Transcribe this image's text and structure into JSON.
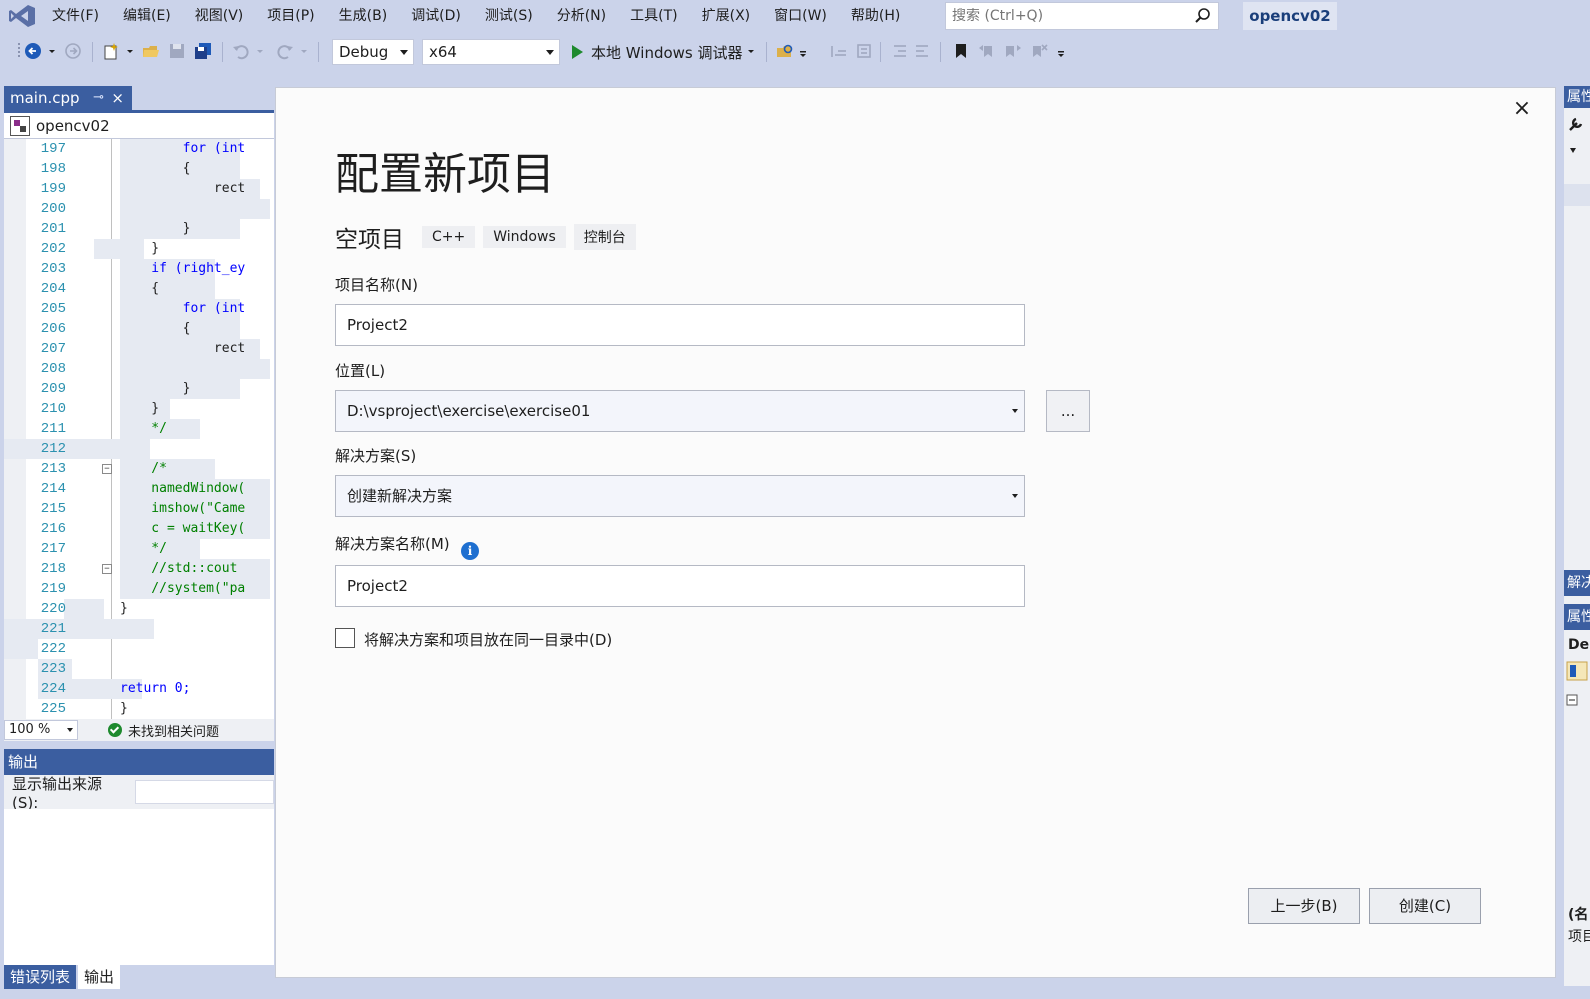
{
  "menubar": {
    "items": [
      "文件(F)",
      "编辑(E)",
      "视图(V)",
      "项目(P)",
      "生成(B)",
      "调试(D)",
      "测试(S)",
      "分析(N)",
      "工具(T)",
      "扩展(X)",
      "窗口(W)",
      "帮助(H)"
    ],
    "search_placeholder": "搜索 (Ctrl+Q)",
    "project_name": "opencv02"
  },
  "toolbar": {
    "config": "Debug",
    "platform": "x64",
    "run_label": "本地 Windows 调试器"
  },
  "editor": {
    "tab_name": "main.cpp",
    "tab_pin": "⊸",
    "tab_close": "×",
    "nav_project": "opencv02",
    "lines": [
      {
        "n": "197",
        "code": "        for (int",
        "kind": "kw"
      },
      {
        "n": "198",
        "code": "        {",
        "kind": "pl"
      },
      {
        "n": "199",
        "code": "            rect",
        "kind": "pl"
      },
      {
        "n": "200",
        "code": "",
        "kind": "pl"
      },
      {
        "n": "201",
        "code": "        }",
        "kind": "pl"
      },
      {
        "n": "202",
        "code": "    }",
        "kind": "pl"
      },
      {
        "n": "203",
        "code": "    if (right_ey",
        "kind": "kw"
      },
      {
        "n": "204",
        "code": "    {",
        "kind": "pl"
      },
      {
        "n": "205",
        "code": "        for (int",
        "kind": "kw"
      },
      {
        "n": "206",
        "code": "        {",
        "kind": "pl"
      },
      {
        "n": "207",
        "code": "            rect",
        "kind": "pl"
      },
      {
        "n": "208",
        "code": "",
        "kind": "pl"
      },
      {
        "n": "209",
        "code": "        }",
        "kind": "pl"
      },
      {
        "n": "210",
        "code": "    }",
        "kind": "pl"
      },
      {
        "n": "211",
        "code": "    */",
        "kind": "cm"
      },
      {
        "n": "212",
        "code": "",
        "kind": "pl"
      },
      {
        "n": "213",
        "code": "    /*",
        "kind": "cm"
      },
      {
        "n": "214",
        "code": "    namedWindow(",
        "kind": "cm"
      },
      {
        "n": "215",
        "code": "    imshow(\"Came",
        "kind": "cm"
      },
      {
        "n": "216",
        "code": "    c = waitKey(",
        "kind": "cm"
      },
      {
        "n": "217",
        "code": "    */",
        "kind": "cm"
      },
      {
        "n": "218",
        "code": "    //std::cout",
        "kind": "cm"
      },
      {
        "n": "219",
        "code": "    //system(\"pa",
        "kind": "cm"
      },
      {
        "n": "220",
        "code": "}",
        "kind": "pl"
      },
      {
        "n": "221",
        "code": "",
        "kind": "pl"
      },
      {
        "n": "222",
        "code": "",
        "kind": "pl"
      },
      {
        "n": "223",
        "code": "",
        "kind": "pl"
      },
      {
        "n": "224",
        "code": "return 0;",
        "kind": "kw"
      },
      {
        "n": "225",
        "code": "}",
        "kind": "pl"
      }
    ],
    "zoom": "100 %",
    "issues_text": "未找到相关问题"
  },
  "output": {
    "title": "输出",
    "source_label": "显示输出来源(S):"
  },
  "bottom_tabs": [
    "错误列表",
    "输出"
  ],
  "right_panel": {
    "top_label": "属性",
    "solution_label": "解决",
    "props_label": "属性",
    "de_label": "De",
    "name_label": "(名",
    "item_label": "项目"
  },
  "dialog": {
    "title": "配置新项目",
    "close": "×",
    "template_name": "空项目",
    "tags": [
      "C++",
      "Windows",
      "控制台"
    ],
    "project_name_label": "项目名称(N)",
    "project_name_value": "Project2",
    "location_label": "位置(L)",
    "location_value": "D:\\vsproject\\exercise\\exercise01",
    "browse_label": "...",
    "solution_label": "解决方案(S)",
    "solution_value": "创建新解决方案",
    "solution_name_label": "解决方案名称(M)",
    "solution_name_value": "Project2",
    "same_dir_label": "将解决方案和项目放在同一目录中(D)",
    "back_button": "上一步(B)",
    "create_button": "创建(C)"
  },
  "colors": {
    "accent": "#3b5ea0",
    "chrome": "#cbd3ea",
    "run_green": "#1e8a2e",
    "info_blue": "#1e6fd0"
  }
}
